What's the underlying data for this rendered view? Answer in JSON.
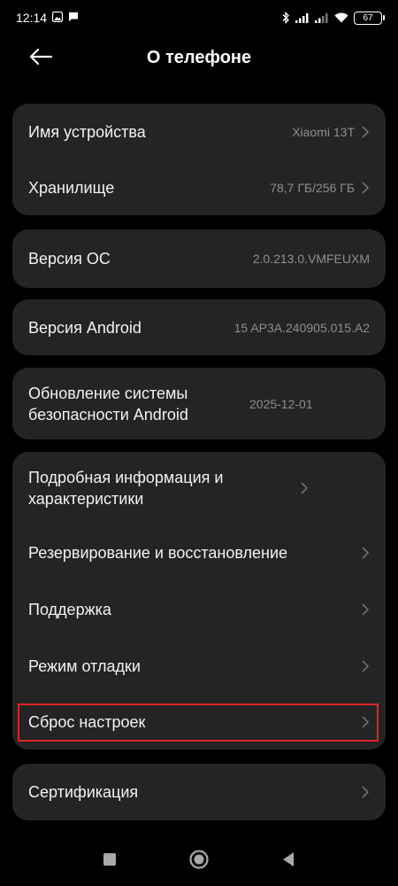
{
  "status_bar": {
    "time": "12:14",
    "battery": "67",
    "icons": [
      "image-icon",
      "message-icon",
      "bluetooth-icon",
      "signal-icon",
      "signal-icon",
      "wifi-icon",
      "battery-icon"
    ]
  },
  "header": {
    "title": "О телефоне",
    "back_icon": "back-arrow-icon"
  },
  "groups": [
    {
      "items": [
        {
          "label": "Имя устройства",
          "value": "Xiaomi 13T",
          "chevron": true
        },
        {
          "label": "Хранилище",
          "value": "78,7 ГБ/256 ГБ",
          "chevron": true
        }
      ]
    },
    {
      "items": [
        {
          "label": "Версия ОС",
          "value": "2.0.213.0.VMFEUXM",
          "chevron": false
        }
      ]
    },
    {
      "items": [
        {
          "label": "Версия Android",
          "value": "15 AP3A.240905.015.A2",
          "chevron": false
        }
      ]
    },
    {
      "items": [
        {
          "label": "Обновление системы безопасности Android",
          "value": "2025-12-01",
          "chevron": false
        }
      ]
    },
    {
      "items": [
        {
          "label": "Подробная информация и характеристики",
          "value": "",
          "chevron": true
        },
        {
          "label": "Резервирование и восстановление",
          "value": "",
          "chevron": true
        },
        {
          "label": "Поддержка",
          "value": "",
          "chevron": true
        },
        {
          "label": "Режим отладки",
          "value": "",
          "chevron": true
        },
        {
          "label": "Сброс настроек",
          "value": "",
          "chevron": true,
          "highlighted": true
        }
      ]
    },
    {
      "items": [
        {
          "label": "Сертификация",
          "value": "",
          "chevron": true
        }
      ]
    }
  ],
  "navbar": {
    "icons": [
      "recents-square-icon",
      "home-circle-icon",
      "back-triangle-icon"
    ]
  },
  "colors": {
    "background": "#000000",
    "card": "#242424",
    "text": "#f2f2f2",
    "secondary_text": "#8e8e8e",
    "highlight": "#e0222a"
  }
}
